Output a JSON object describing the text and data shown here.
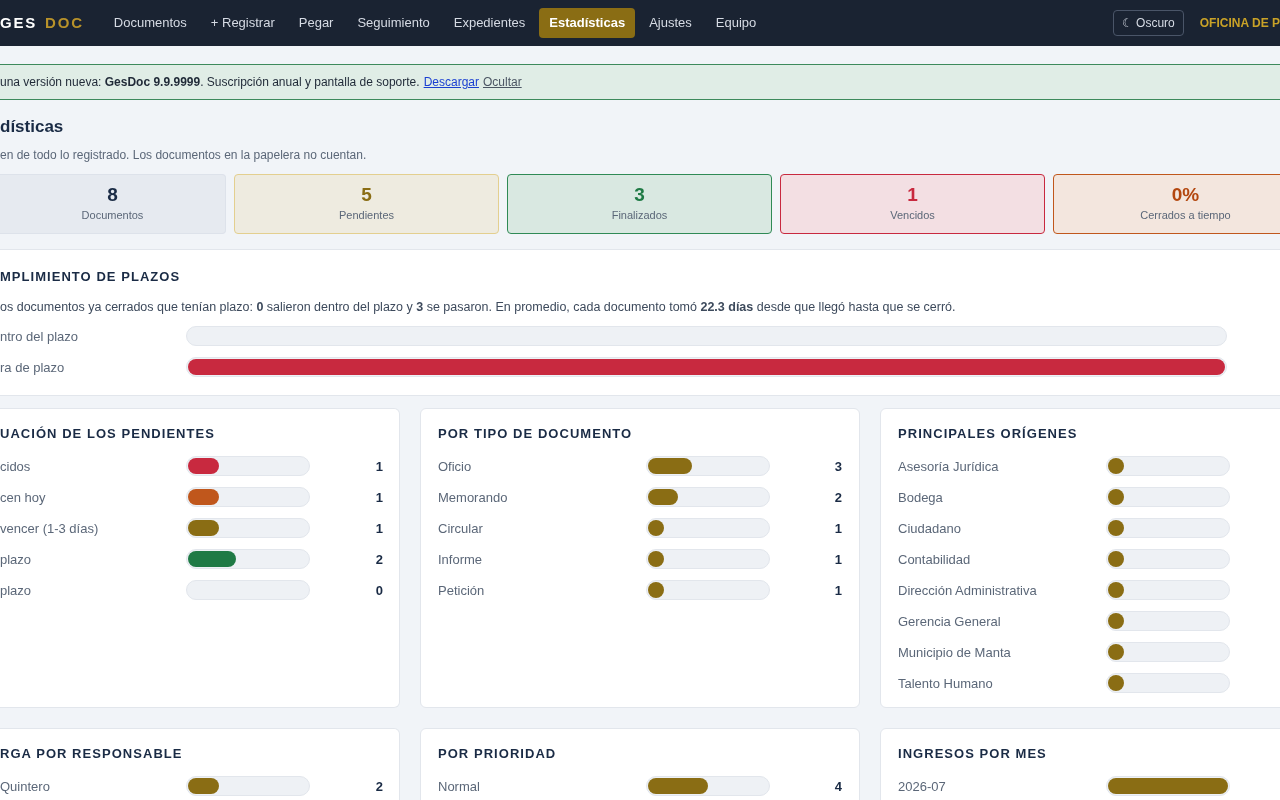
{
  "nav": {
    "logo_a": "GES",
    "logo_b": "DOC",
    "items": [
      {
        "label": "Documentos",
        "selected": false
      },
      {
        "label": "+ Registrar",
        "selected": false
      },
      {
        "label": "Pegar",
        "selected": false
      },
      {
        "label": "Seguimiento",
        "selected": false
      },
      {
        "label": "Expedientes",
        "selected": false
      },
      {
        "label": "Estadísticas",
        "selected": true
      },
      {
        "label": "Ajustes",
        "selected": false
      },
      {
        "label": "Equipo",
        "selected": false
      }
    ],
    "theme_button": "☾ Oscuro",
    "office": "OFICINA DE P"
  },
  "banner": {
    "text": "una versión nueva: **GesDoc 9.9.9999**. Suscripción anual y pantalla de soporte.",
    "download": "Descargar",
    "hide": "Ocultar"
  },
  "title": "dísticas",
  "subtitle": "en de todo lo registrado. Los documentos en la papelera no cuentan.",
  "stats": [
    {
      "value": "8",
      "label": "Documentos",
      "kind": "neutral"
    },
    {
      "value": "5",
      "label": "Pendientes",
      "kind": "warning"
    },
    {
      "value": "3",
      "label": "Finalizados",
      "kind": "success"
    },
    {
      "value": "1",
      "label": "Vencidos",
      "kind": "danger"
    },
    {
      "value": "0%",
      "label": "Cerrados a tiempo",
      "kind": "orange"
    }
  ],
  "compliance": {
    "heading": "MPLIMIENTO DE PLAZOS",
    "text": "os documentos ya cerrados que tenían plazo: **0** salieron dentro del plazo y **3** se pasaron. En promedio, cada documento tomó **22.3 días** desde que llegó hasta que se cerró.",
    "rows": [
      {
        "label": "ntro del plazo"
      },
      {
        "label": "ra de plazo",
        "level": 1,
        "color": "#c8293f"
      }
    ]
  },
  "cards": [
    {
      "heading": "UACIÓN DE LOS PENDIENTES",
      "rows": [
        {
          "label": "cidos",
          "level": 0.26,
          "color": "#c8293f",
          "count": "1"
        },
        {
          "label": "cen hoy",
          "level": 0.26,
          "color": "#c0571c",
          "count": "1"
        },
        {
          "label": "vencer (1-3 días)",
          "level": 0.26,
          "color": "#8a6d14",
          "count": "1"
        },
        {
          "label": "plazo",
          "level": 0.4,
          "color": "#1f7a45",
          "count": "2"
        },
        {
          "label": "plazo",
          "count": "0"
        }
      ]
    },
    {
      "heading": "POR TIPO DE DOCUMENTO",
      "rows": [
        {
          "label": "Oficio",
          "level": 0.37,
          "color": "#8a6d14",
          "count": "3"
        },
        {
          "label": "Memorando",
          "level": 0.25,
          "color": "#8a6d14",
          "count": "2"
        },
        {
          "label": "Circular",
          "level": 0.13,
          "color": "#8a6d14",
          "count": "1"
        },
        {
          "label": "Informe",
          "level": 0.13,
          "color": "#8a6d14",
          "count": "1"
        },
        {
          "label": "Petición",
          "level": 0.13,
          "color": "#8a6d14",
          "count": "1"
        }
      ]
    },
    {
      "heading": "PRINCIPALES ORÍGENES",
      "rows": [
        {
          "label": "Asesoría Jurídica",
          "level": 0.13,
          "color": "#8a6d14"
        },
        {
          "label": "Bodega",
          "level": 0.13,
          "color": "#8a6d14"
        },
        {
          "label": "Ciudadano",
          "level": 0.13,
          "color": "#8a6d14"
        },
        {
          "label": "Contabilidad",
          "level": 0.13,
          "color": "#8a6d14"
        },
        {
          "label": "Dirección Administrativa",
          "level": 0.13,
          "color": "#8a6d14"
        },
        {
          "label": "Gerencia General",
          "level": 0.13,
          "color": "#8a6d14"
        },
        {
          "label": "Municipio de Manta",
          "level": 0.13,
          "color": "#8a6d14"
        },
        {
          "label": "Talento Humano",
          "level": 0.13,
          "color": "#8a6d14"
        }
      ]
    },
    {
      "heading": "RGA POR RESPONSABLE",
      "rows": [
        {
          "label": "Quintero",
          "level": 0.26,
          "color": "#8a6d14",
          "count": "2"
        }
      ]
    },
    {
      "heading": "POR PRIORIDAD",
      "rows": [
        {
          "label": "Normal",
          "level": 0.5,
          "color": "#8a6d14",
          "count": "4"
        }
      ]
    },
    {
      "heading": "INGRESOS POR MES",
      "rows": [
        {
          "label": "2026-07",
          "level": 1,
          "color": "#8a6d14"
        }
      ]
    }
  ]
}
